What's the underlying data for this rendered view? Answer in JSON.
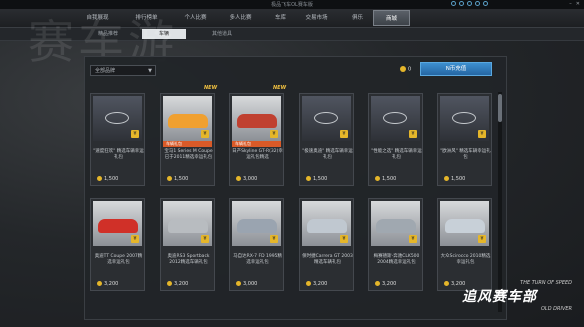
{
  "window": {
    "title": "极品飞车OL赛车版"
  },
  "nav": {
    "tabs": [
      {
        "label": "自我展现"
      },
      {
        "label": "排行榜单"
      },
      {
        "label": "个人比赛"
      },
      {
        "label": "多人比赛"
      },
      {
        "label": "车库"
      },
      {
        "label": "交易市场"
      },
      {
        "label": "俱乐"
      },
      {
        "label": "商城"
      }
    ]
  },
  "subnav": {
    "tabs": [
      {
        "label": "精品推荐"
      },
      {
        "label": "车辆"
      },
      {
        "label": "其他道具"
      }
    ]
  },
  "watermark": "赛车游",
  "filter": {
    "value": "全部品牌"
  },
  "balance": {
    "value": "0"
  },
  "buy_button": {
    "label": "N币充值"
  },
  "cards": [
    {
      "desc": "\"速度狂欢\" 精选车辆幸运礼包",
      "price": "1,500",
      "new": "",
      "brand": "bmw",
      "bar": ""
    },
    {
      "desc": "宝马1 Series M Coupe已于2011精选幸运礼包",
      "price": "1,500",
      "new": "NEW",
      "brand": "car",
      "bar": "车辆礼包"
    },
    {
      "desc": "日产Skyline GT-R(32)幸运礼包精选",
      "price": "3,000",
      "new": "NEW",
      "brand": "car",
      "bar": "车辆礼包"
    },
    {
      "desc": "\"极速奥迪\" 精选车辆幸运礼包",
      "price": "1,500",
      "new": "",
      "brand": "audi",
      "bar": ""
    },
    {
      "desc": "\"性能之选\" 精选车辆幸运礼包",
      "price": "1,500",
      "new": "",
      "brand": "mazda",
      "bar": ""
    },
    {
      "desc": "\"欧洲风\" 精选车辆幸运礼包",
      "price": "1,500",
      "new": "",
      "brand": "benz",
      "bar": ""
    },
    {
      "desc": "奥迪TT Coupe 2007精选幸运礼包",
      "price": "3,200",
      "new": "",
      "brand": "car",
      "bar": ""
    },
    {
      "desc": "奥迪RS3 Sportback 2012精选车辆礼包",
      "price": "3,200",
      "new": "",
      "brand": "car",
      "bar": ""
    },
    {
      "desc": "马自达RX-7 FD 1995精选幸运礼包",
      "price": "3,000",
      "new": "",
      "brand": "car",
      "bar": ""
    },
    {
      "desc": "保时捷Carrera GT 2003精选车辆礼包",
      "price": "3,200",
      "new": "",
      "brand": "car",
      "bar": ""
    },
    {
      "desc": "梅赛德斯-奔驰CLK500 2004精选幸运礼包",
      "price": "3,200",
      "new": "",
      "brand": "car",
      "bar": ""
    },
    {
      "desc": "大众Scirocco 2010精选幸运礼包",
      "price": "3,200",
      "new": "",
      "brand": "car",
      "bar": ""
    }
  ],
  "brand_logo": {
    "top": "THE TURN OF SPEED",
    "main": "追风赛车部",
    "bottom": "OLD DRIVER"
  },
  "colors": {
    "accent": "#2f7fc2",
    "coin": "#e5b62a",
    "new": "#f0c040",
    "bar": "#d95a28"
  }
}
